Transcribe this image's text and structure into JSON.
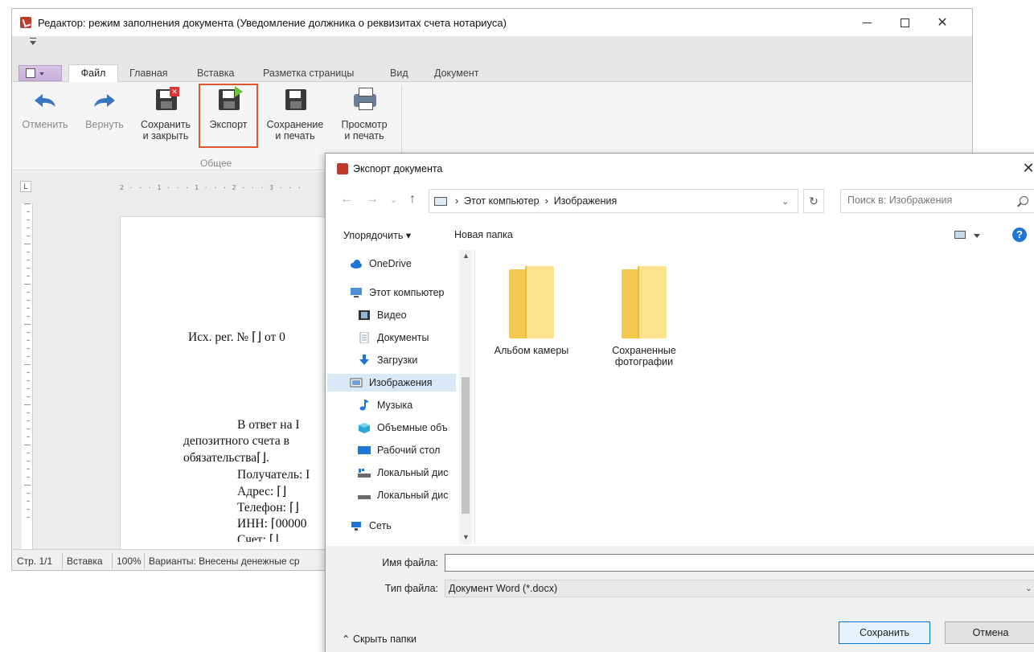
{
  "editor": {
    "title": "Редактор: режим заполнения документа (Уведомление должника о реквизитах счета нотариуса)",
    "window_controls": {
      "minimize": "—",
      "maximize": "☐",
      "close": "✕"
    },
    "tabs": [
      {
        "label": "Файл",
        "active": true
      },
      {
        "label": "Главная"
      },
      {
        "label": "Вставка"
      },
      {
        "label": "Разметка страницы"
      },
      {
        "label": "Вид"
      },
      {
        "label": "Документ"
      }
    ],
    "ribbon": {
      "undo": {
        "line1": "Отменить",
        "line2": "",
        "icon": "undo-arrow-icon"
      },
      "redo": {
        "line1": "Вернуть",
        "line2": "",
        "icon": "redo-arrow-icon"
      },
      "save_close": {
        "line1": "Сохранить",
        "line2": "и закрыть",
        "icon": "save-close-icon"
      },
      "export": {
        "line1": "Экспорт",
        "line2": "",
        "icon": "export-icon"
      },
      "save_print": {
        "line1": "Сохранение",
        "line2": "и печать",
        "icon": "save-print-icon"
      },
      "preview_print": {
        "line1": "Просмотр",
        "line2": "и печать",
        "icon": "printer-icon"
      },
      "group_label": "Общее",
      "highlight_color": "#e2572b"
    },
    "ruler": {
      "corner": "L",
      "marks": "2 · · · 1 · · · 1 · · · 2 · · · 3 · · ·"
    },
    "document": {
      "line_ref": "Исх. рег. № ⌈⌋ от 0",
      "line_answer": "В ответ на I",
      "line_deposit": "депозитного счета в",
      "line_obligation": "обязательства⌈⌋.",
      "line_recipient": "Получатель: I",
      "line_address": "Адрес: ⌈⌋",
      "line_phone": "Телефон: ⌈⌋",
      "line_inn": "ИНН: ⌈00000",
      "line_account": "Счет: ⌈⌋"
    },
    "statusbar": {
      "page": "Стр. 1/1",
      "mode": "Вставка",
      "zoom": "100%",
      "variants": "Варианты: Внесены денежные ср"
    }
  },
  "dialog": {
    "title": "Экспорт документа",
    "close": "✕",
    "nav": {
      "back": "←",
      "forward": "→",
      "recent": "⌄",
      "up": "↑"
    },
    "address": {
      "path": [
        "Этот компьютер",
        "Изображения"
      ],
      "separator": "›",
      "dropdown": "⌄",
      "refresh": "↻"
    },
    "search": {
      "placeholder": "Поиск в: Изображения"
    },
    "commands": {
      "organize": "Упорядочить ▾",
      "new_folder": "Новая папка",
      "help": "?"
    },
    "nav_pane": [
      {
        "label": "OneDrive",
        "icon": "cloud-icon",
        "color": "#1f74d8"
      },
      {
        "label": "Этот компьютер",
        "icon": "computer-icon",
        "color": "#4a90d9"
      },
      {
        "label": "Видео",
        "icon": "video-icon",
        "color": "#333333"
      },
      {
        "label": "Документы",
        "icon": "documents-icon",
        "color": "#8aa1b5"
      },
      {
        "label": "Загрузки",
        "icon": "downloads-icon",
        "color": "#1f74d8"
      },
      {
        "label": "Изображения",
        "icon": "pictures-icon",
        "color": "#6fa3d6",
        "selected": true
      },
      {
        "label": "Музыка",
        "icon": "music-icon",
        "color": "#1f74d8"
      },
      {
        "label": "Объемные объ",
        "icon": "3d-objects-icon",
        "color": "#2aa6d8"
      },
      {
        "label": "Рабочий стол",
        "icon": "desktop-icon",
        "color": "#1f74d8"
      },
      {
        "label": "Локальный дис",
        "icon": "drive-c-icon",
        "color": "#6a6a6a"
      },
      {
        "label": "Локальный дис",
        "icon": "drive-icon",
        "color": "#6a6a6a"
      },
      {
        "label": "Сеть",
        "icon": "network-icon",
        "color": "#1f74d8"
      }
    ],
    "folders": [
      {
        "line1": "Альбом камеры",
        "line2": ""
      },
      {
        "line1": "Сохраненные",
        "line2": "фотографии"
      }
    ],
    "form": {
      "filename_label": "Имя файла:",
      "filename_value": "",
      "filetype_label": "Тип файла:",
      "filetype_value": "Документ Word (*.docx)",
      "hide_folders": "⌃ Скрыть папки",
      "save": "Сохранить",
      "cancel": "Отмена"
    }
  }
}
